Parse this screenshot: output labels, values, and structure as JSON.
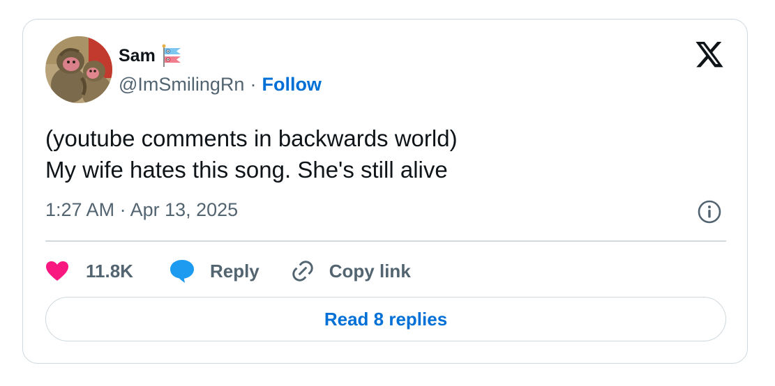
{
  "author": {
    "display_name": "Sam",
    "name_emoji": "carp-streamer-emoji",
    "handle": "@ImSmilingRn",
    "separator": "·",
    "follow_label": "Follow",
    "avatar": "monkeys-painting-avatar"
  },
  "platform_logo": "x-logo",
  "tweet": {
    "lines": [
      "(youtube comments in backwards world)",
      "My wife hates this song. She's still alive"
    ],
    "timestamp": "1:27 AM · Apr 13, 2025"
  },
  "actions": {
    "like_count": "11.8K",
    "reply_label": "Reply",
    "copy_link_label": "Copy link"
  },
  "read_replies_label": "Read 8 replies",
  "colors": {
    "like": "#f91880",
    "reply": "#1d9bf0",
    "link": "#006fd6",
    "muted": "#536471",
    "border": "#cfd9de"
  }
}
